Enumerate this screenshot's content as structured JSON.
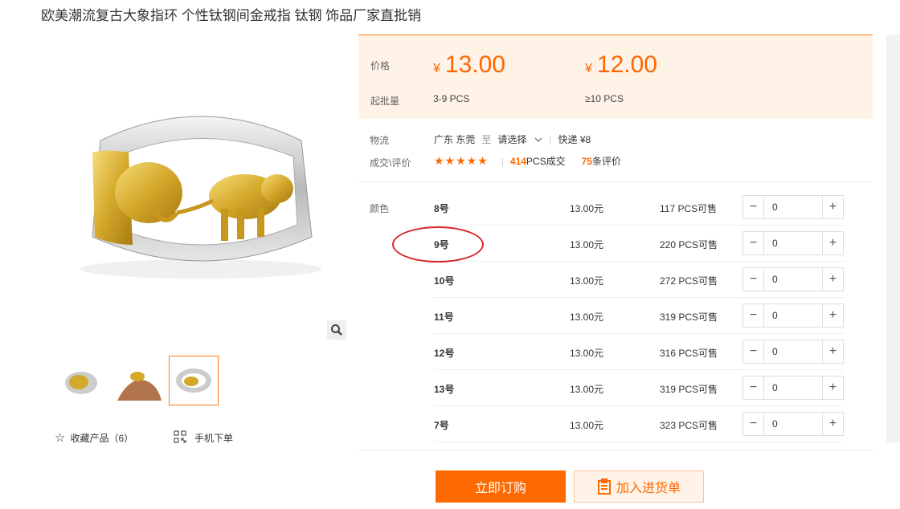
{
  "title": "欧美潮流复古大象指环 个性钛钢间金戒指 钛钢 饰品厂家直批销",
  "gallery": {
    "favorite_label": "收藏产品（6）",
    "mobile_label": "手机下单"
  },
  "price_panel": {
    "price_label": "价格",
    "batch_label": "起批量",
    "currency": "¥",
    "tiers": [
      {
        "price": "13.00",
        "batch": "3-9 PCS"
      },
      {
        "price": "12.00",
        "batch": "≥10 PCS"
      }
    ]
  },
  "logistics": {
    "label": "物流",
    "origin": "广东 东莞",
    "to": "至",
    "destination_select": "请选择",
    "express": "快递 ¥8"
  },
  "deals": {
    "label": "成交\\评价",
    "stars": "★★★★★",
    "rating": 5,
    "sold_count": "414",
    "sold_suffix": "PCS成交",
    "review_count": "75",
    "review_suffix": "条评价",
    "divider": "|"
  },
  "sku": {
    "label": "颜色",
    "rows": [
      {
        "name": "8号",
        "price": "13.00元",
        "stock": "117 PCS可售",
        "qty": "0"
      },
      {
        "name": "9号",
        "price": "13.00元",
        "stock": "220 PCS可售",
        "qty": "0"
      },
      {
        "name": "10号",
        "price": "13.00元",
        "stock": "272 PCS可售",
        "qty": "0"
      },
      {
        "name": "11号",
        "price": "13.00元",
        "stock": "319 PCS可售",
        "qty": "0"
      },
      {
        "name": "12号",
        "price": "13.00元",
        "stock": "316 PCS可售",
        "qty": "0"
      },
      {
        "name": "13号",
        "price": "13.00元",
        "stock": "319 PCS可售",
        "qty": "0"
      },
      {
        "name": "7号",
        "price": "13.00元",
        "stock": "323 PCS可售",
        "qty": "0"
      }
    ],
    "minus": "−",
    "plus": "+"
  },
  "actions": {
    "buy_label": "立即订购",
    "cart_label": "加入进货单"
  },
  "colors": {
    "accent": "#ff6a00",
    "panel_bg": "#fff3e8",
    "annotation": "#d8262a"
  }
}
